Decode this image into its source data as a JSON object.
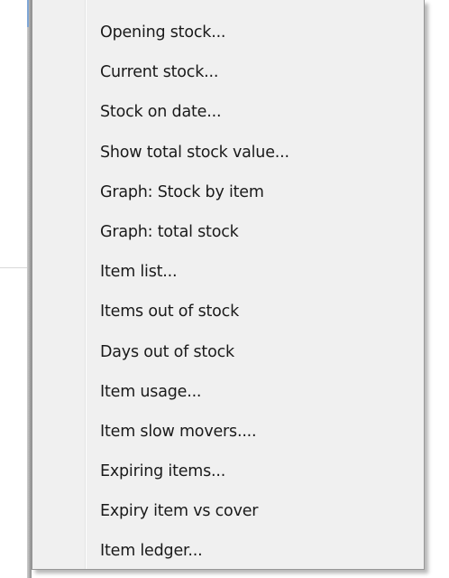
{
  "menu": {
    "items": [
      {
        "label": "Opening stock..."
      },
      {
        "label": "Current stock..."
      },
      {
        "label": "Stock on date..."
      },
      {
        "label": "Show total stock value..."
      },
      {
        "label": "Graph: Stock by item"
      },
      {
        "label": "Graph: total stock"
      },
      {
        "label": "Item list..."
      },
      {
        "label": "Items out of stock"
      },
      {
        "label": "Days out of stock"
      },
      {
        "label": "Item usage..."
      },
      {
        "label": "Item slow movers...."
      },
      {
        "label": "Expiring items..."
      },
      {
        "label": "Expiry item vs cover"
      },
      {
        "label": "Item ledger..."
      }
    ]
  },
  "colors": {
    "menu_background": "#f0f0f0",
    "menu_border": "#979797",
    "text": "#1a1a1a",
    "hover": "#e5f1fb"
  }
}
